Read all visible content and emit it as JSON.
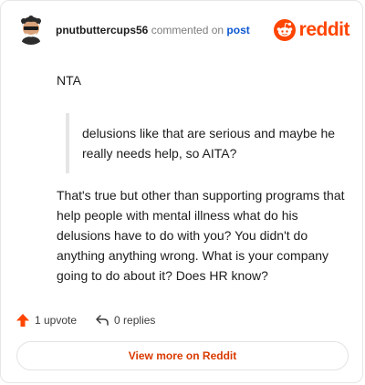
{
  "header": {
    "username": "pnutbuttercups56",
    "action_text": "commented on",
    "post_link": "post",
    "brand_name": "reddit",
    "brand_color": "#ff4500"
  },
  "comment": {
    "paragraph1": "NTA",
    "quote": "delusions like that are serious and maybe he really needs help, so AITA?",
    "paragraph2": "That's true but other than supporting programs that help people with mental illness what do his delusions have to do with you? You didn't do anything anything wrong. What is your company going to do about it? Does HR know?"
  },
  "actions": {
    "upvote_label": "1 upvote",
    "replies_label": "0 replies",
    "upvote_icon": "arrow-up-icon",
    "reply_icon": "reply-icon"
  },
  "footer": {
    "view_more_label": "View more on Reddit"
  }
}
